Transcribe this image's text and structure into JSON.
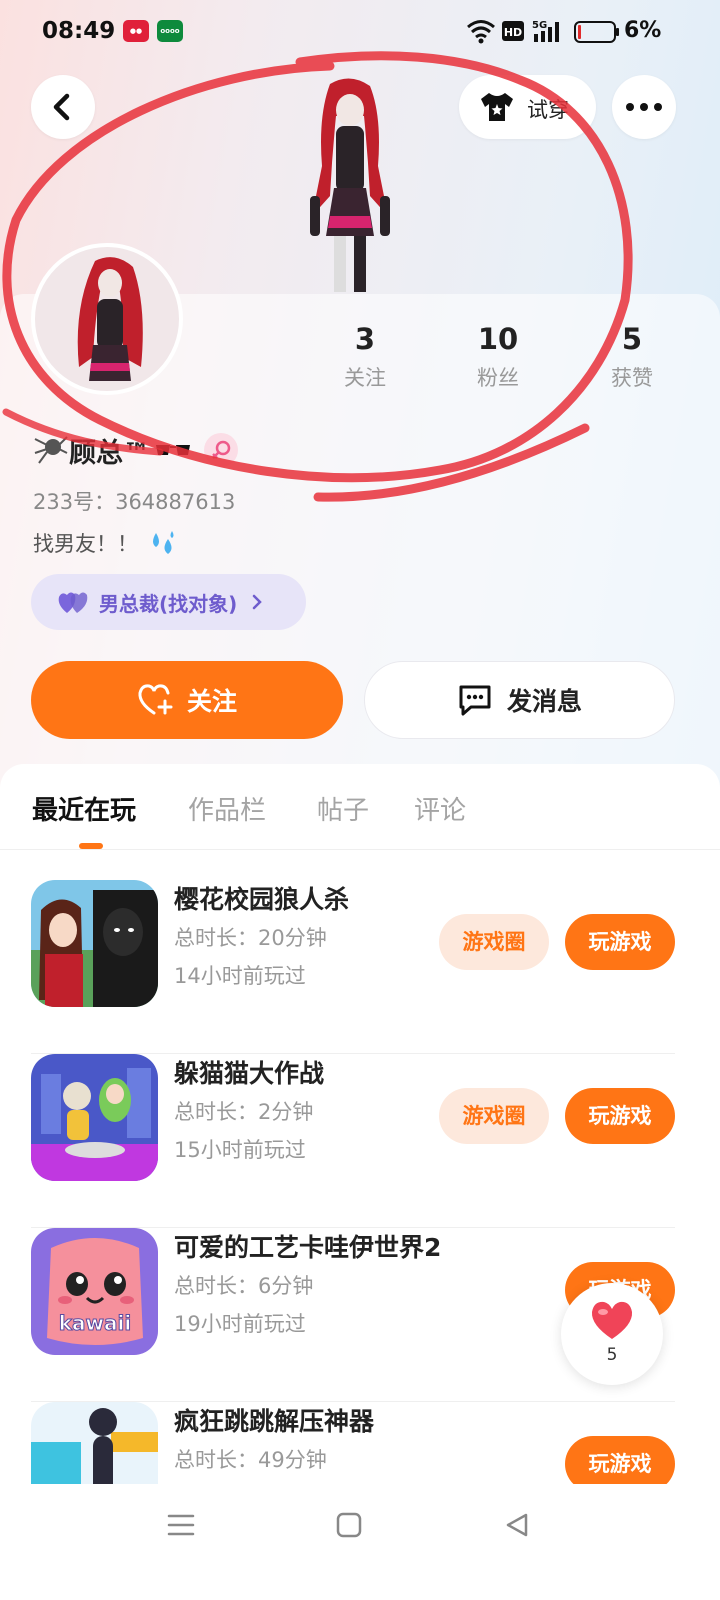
{
  "status_bar": {
    "time": "08:49",
    "battery": "6%",
    "network": "5G",
    "hd": "HD",
    "icons": [
      "notification-app-red-icon",
      "notification-app-green-icon",
      "wifi-icon",
      "hd-icon",
      "signal-5g-icon",
      "battery-icon"
    ]
  },
  "header": {
    "try_on_label": "试穿"
  },
  "profile": {
    "stats": [
      {
        "value": "3",
        "label": "关注"
      },
      {
        "value": "10",
        "label": "粉丝"
      },
      {
        "value": "5",
        "label": "获赞"
      }
    ],
    "username": "顾总™",
    "user_id": "233号：364887613",
    "bio": "找男友！！",
    "tag_label": "男总裁(找对象)",
    "follow_label": "关注",
    "message_label": "发消息"
  },
  "tabs": [
    {
      "label": "最近在玩",
      "active": true
    },
    {
      "label": "作品栏",
      "active": false
    },
    {
      "label": "帖子",
      "active": false
    },
    {
      "label": "评论",
      "active": false
    }
  ],
  "games": [
    {
      "title": "樱花校园狼人杀",
      "duration": "总时长：20分钟",
      "last_played": "14小时前玩过",
      "circle_label": "游戏圈",
      "play_label": "玩游戏"
    },
    {
      "title": "躲猫猫大作战",
      "duration": "总时长：2分钟",
      "last_played": "15小时前玩过",
      "circle_label": "游戏圈",
      "play_label": "玩游戏"
    },
    {
      "title": "可爱的工艺卡哇伊世界2",
      "duration": "总时长：6分钟",
      "last_played": "19小时前玩过",
      "play_label": "玩游戏",
      "thumb_text": "kawaii"
    },
    {
      "title": "疯狂跳跳解压神器",
      "duration": "总时长：49分钟",
      "play_label": "玩游戏"
    }
  ],
  "like_float": {
    "count": "5"
  },
  "colors": {
    "accent": "#ff7515",
    "tag_purple": "#6e5ccd",
    "annotation_red": "#e8303a"
  }
}
